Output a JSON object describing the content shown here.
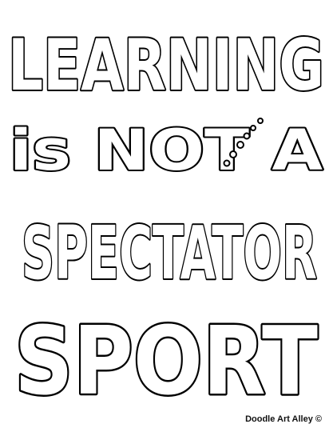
{
  "artwork": {
    "lines": [
      "LEARNING",
      "is NOT A",
      "SPECTATOR",
      "SPORT"
    ]
  },
  "credit": {
    "text": "Doodle Art Alley ©"
  },
  "colors": {
    "ink": "#000000",
    "paper": "#ffffff"
  }
}
